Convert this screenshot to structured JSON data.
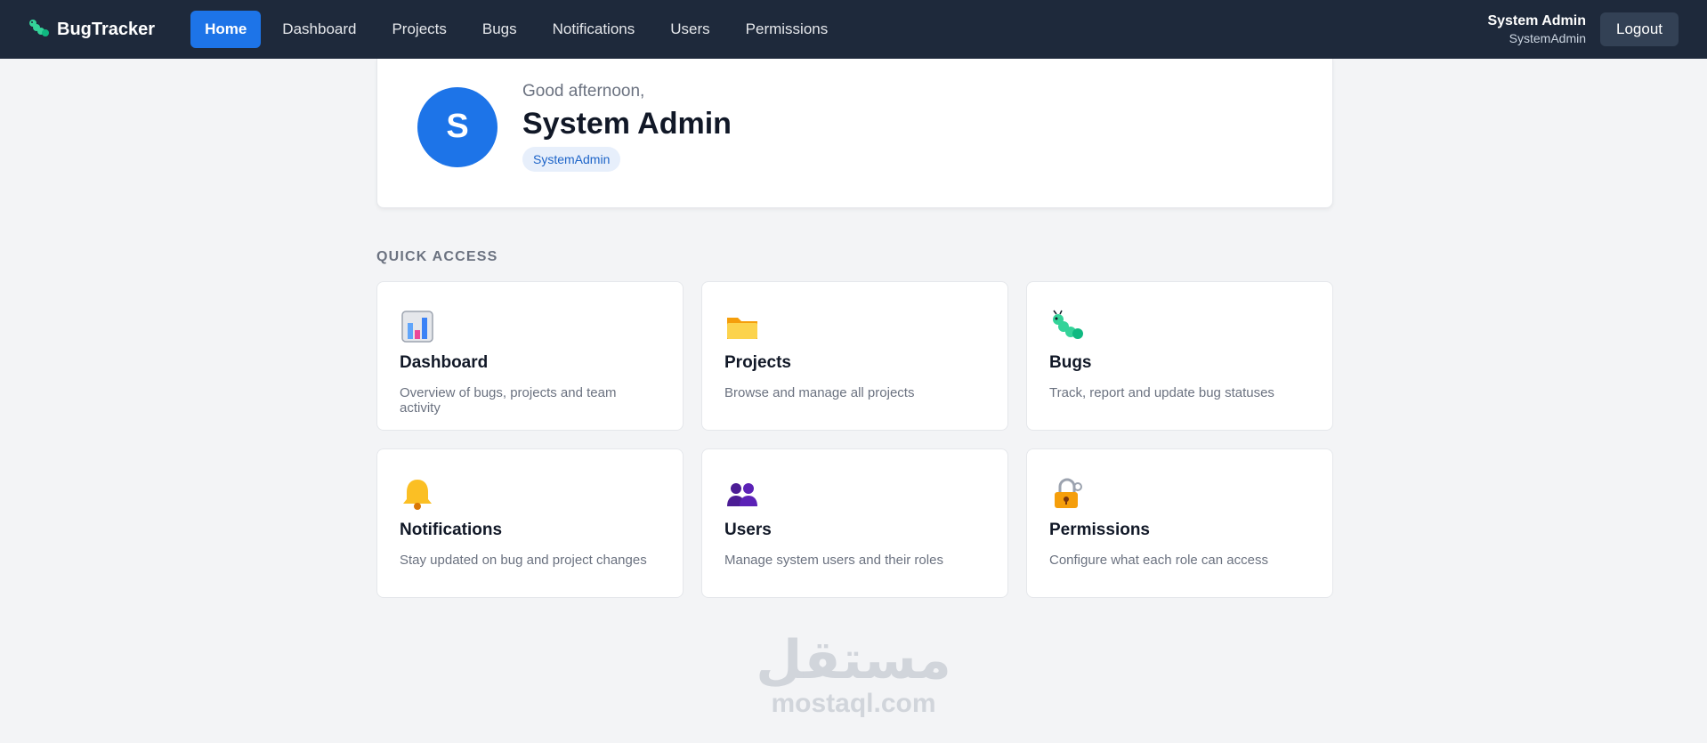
{
  "brand": {
    "name": "BugTracker",
    "icon": "caterpillar-icon",
    "accent": "#34d399"
  },
  "nav": {
    "items": [
      {
        "label": "Home",
        "active": true
      },
      {
        "label": "Dashboard",
        "active": false
      },
      {
        "label": "Projects",
        "active": false
      },
      {
        "label": "Bugs",
        "active": false
      },
      {
        "label": "Notifications",
        "active": false
      },
      {
        "label": "Users",
        "active": false
      },
      {
        "label": "Permissions",
        "active": false
      }
    ]
  },
  "user": {
    "name": "System Admin",
    "role": "SystemAdmin",
    "logout_label": "Logout"
  },
  "welcome": {
    "greeting": "Good afternoon,",
    "name": "System Admin",
    "avatar_letter": "S",
    "role_badge": "SystemAdmin"
  },
  "quick_access": {
    "title": "QUICK ACCESS",
    "cards": [
      {
        "icon": "bar-chart-icon",
        "title": "Dashboard",
        "description": "Overview of bugs, projects and team activity"
      },
      {
        "icon": "folder-icon",
        "title": "Projects",
        "description": "Browse and manage all projects"
      },
      {
        "icon": "bug-icon",
        "title": "Bugs",
        "description": "Track, report and update bug statuses"
      },
      {
        "icon": "bell-icon",
        "title": "Notifications",
        "description": "Stay updated on bug and project changes"
      },
      {
        "icon": "users-icon",
        "title": "Users",
        "description": "Manage system users and their roles"
      },
      {
        "icon": "lock-icon",
        "title": "Permissions",
        "description": "Configure what each role can access"
      }
    ]
  },
  "colors": {
    "nav_bg": "#1e293b",
    "primary": "#1d74e8",
    "page_bg": "#f3f4f6"
  },
  "watermark": {
    "arabic": "مستقل",
    "latin": "mostaql.com"
  }
}
